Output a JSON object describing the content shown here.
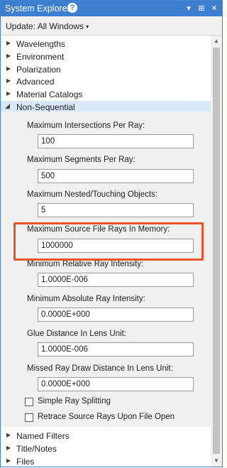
{
  "window": {
    "title": "System Explorer",
    "help_glyph": "?",
    "menu_glyph": "▾",
    "pin_glyph": "⊞",
    "close_glyph": "✕"
  },
  "update": {
    "label": "Update: All Windows",
    "caret": "▾"
  },
  "tree": {
    "collapsed_arrow": "▶",
    "expanded_arrow": "◢",
    "items_top": [
      {
        "label": "Wavelengths"
      },
      {
        "label": "Environment"
      },
      {
        "label": "Polarization"
      },
      {
        "label": "Advanced"
      },
      {
        "label": "Material Catalogs"
      }
    ],
    "selected": {
      "label": "Non-Sequential"
    },
    "items_bottom": [
      {
        "label": "Named Filters"
      },
      {
        "label": "Title/Notes"
      },
      {
        "label": "Files"
      }
    ]
  },
  "fields": [
    {
      "label": "Maximum Intersections Per Ray:",
      "value": "100"
    },
    {
      "label": "Maximum Segments Per Ray:",
      "value": "500"
    },
    {
      "label": "Maximum Nested/Touching Objects:",
      "value": "5"
    },
    {
      "label": "Maximum Source File Rays In Memory:",
      "value": "1000000"
    },
    {
      "label": "Minimum Relative Ray Intensity:",
      "value": "1.0000E-006"
    },
    {
      "label": "Minimum Absolute Ray Intensity:",
      "value": "0.0000E+000"
    },
    {
      "label": "Glue Distance In Lens Unit:",
      "value": "1.0000E-006"
    },
    {
      "label": "Missed Ray Draw Distance In Lens Unit:",
      "value": "0.0000E+000"
    }
  ],
  "checkboxes": [
    {
      "label": "Simple Ray Splitting",
      "checked": false
    },
    {
      "label": "Retrace Source Rays Upon File Open",
      "checked": false
    }
  ],
  "colors": {
    "titlebar": "#3d7fce",
    "selected_row": "#d9e8f9",
    "highlight": "#e8522a"
  },
  "scrollbar": {
    "up_glyph": "▲",
    "down_glyph": "▼"
  }
}
